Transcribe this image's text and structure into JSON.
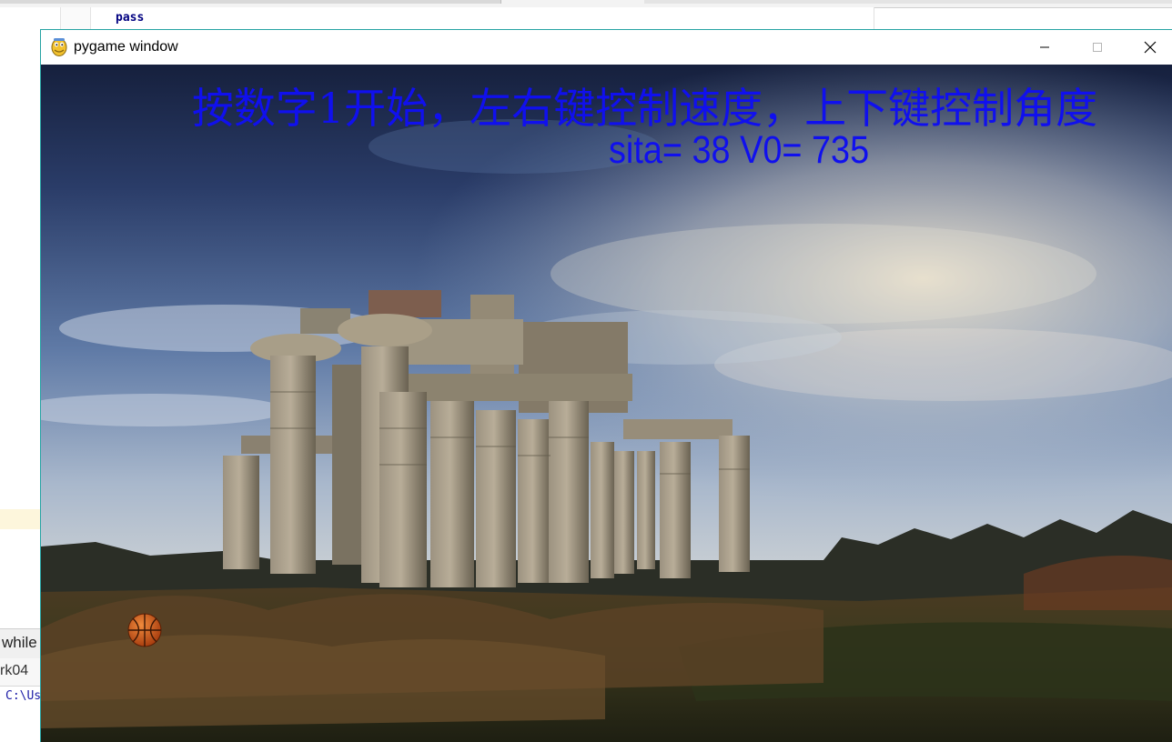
{
  "editor": {
    "code_line": "pass",
    "snippet_while": "while",
    "snippet_run": "rk04",
    "console_path": "C:\\Us"
  },
  "window": {
    "title": "pygame window",
    "icon": "pygame-snake-icon",
    "controls": {
      "minimize": "minimize-icon",
      "maximize": "maximize-icon",
      "close": "close-icon"
    }
  },
  "game": {
    "instruction": "按数字1开始，左右键控制速度，上下键控制角度",
    "status": "sita= 38 V0= 735",
    "text_color": "#1010ee",
    "background": "temple-ruins-landscape",
    "projectile": "basketball"
  }
}
